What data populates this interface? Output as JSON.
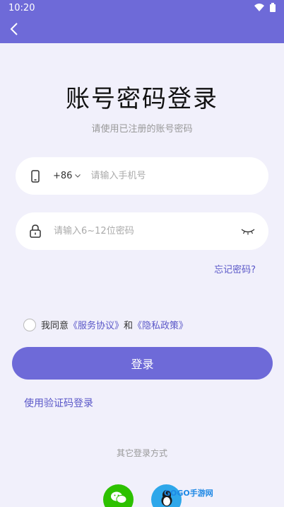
{
  "status_bar": {
    "time": "10:20"
  },
  "header": {
    "back_icon": "chevron-left-icon"
  },
  "title": "账号密码登录",
  "subtitle": "请使用已注册的账号密码",
  "phone": {
    "country_code": "+86",
    "placeholder": "请输入手机号",
    "value": ""
  },
  "password": {
    "placeholder": "请输入6~12位密码",
    "value": ""
  },
  "forgot_password": "忘记密码?",
  "agreement": {
    "prefix": "我同意",
    "service": "《服务协议》",
    "and": "和",
    "privacy": "《隐私政策》",
    "checked": false
  },
  "login_button": "登录",
  "sms_login": "使用验证码登录",
  "other_methods": "其它登录方式",
  "watermark": "GOGO手游网",
  "colors": {
    "accent": "#6e6ad8",
    "link": "#5a57c8",
    "background": "#f1f0fb",
    "wechat": "#2dc100",
    "qq": "#2ea7ea"
  }
}
